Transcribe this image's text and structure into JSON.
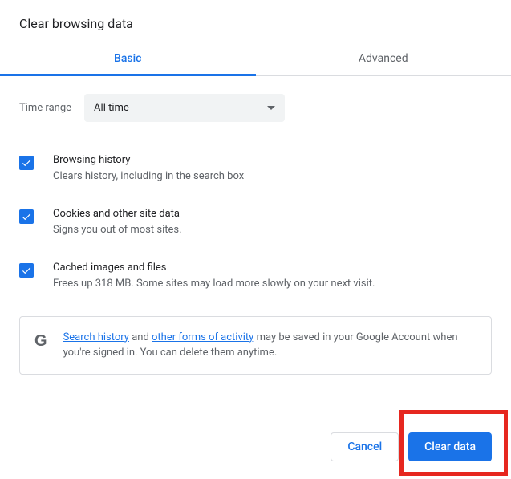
{
  "dialog": {
    "title": "Clear browsing data"
  },
  "tabs": {
    "basic": "Basic",
    "advanced": "Advanced"
  },
  "timerange": {
    "label": "Time range",
    "value": "All time"
  },
  "items": [
    {
      "title": "Browsing history",
      "desc": "Clears history, including in the search box"
    },
    {
      "title": "Cookies and other site data",
      "desc": "Signs you out of most sites."
    },
    {
      "title": "Cached images and files",
      "desc": "Frees up 318 MB. Some sites may load more slowly on your next visit."
    }
  ],
  "notice": {
    "link1": "Search history",
    "mid1": " and ",
    "link2": "other forms of activity",
    "rest": " may be saved in your Google Account when you're signed in. You can delete them anytime."
  },
  "buttons": {
    "cancel": "Cancel",
    "clear": "Clear data"
  }
}
